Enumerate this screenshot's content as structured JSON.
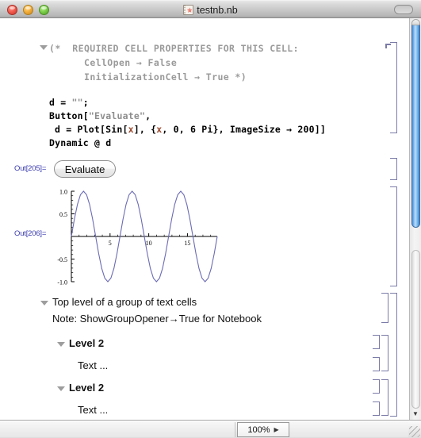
{
  "window": {
    "title": "testnb.nb",
    "icon": "mathematica-notebook-icon",
    "close_label": "",
    "minimize_label": "",
    "maximize_label": "",
    "toolbar_toggle_label": ""
  },
  "code_cell": {
    "opener": "▼",
    "comment": {
      "line1": "(*  REQUIRED CELL PROPERTIES FOR THIS CELL:",
      "line2": "CellOpen → False",
      "line3": "InitializationCell → True *)"
    },
    "lines": {
      "l1_a": "d = ",
      "l1_str": "\"\"",
      "l1_b": ";",
      "l2_a": "Button[",
      "l2_str": "\"Evaluate\"",
      "l2_b": ",",
      "l3_a": "d = Plot[Sin[",
      "l3_x1": "x",
      "l3_b": "], {",
      "l3_x2": "x",
      "l3_c": ", 0, 6 Pi}, ImageSize → 200]]",
      "l4": "Dynamic @ d"
    }
  },
  "outputs": {
    "out205_label": "Out[205]=",
    "evaluate_button_label": "Evaluate",
    "out206_label": "Out[206]="
  },
  "chart_data": {
    "type": "line",
    "title": "",
    "xlabel": "",
    "ylabel": "",
    "expression": "Sin[x]",
    "xlim": [
      0,
      18.8496
    ],
    "ylim": [
      -1.0,
      1.0
    ],
    "xticks": [
      5,
      10,
      15
    ],
    "xtick_labels": [
      "5",
      "10",
      "15"
    ],
    "yticks": [
      -1.0,
      -0.5,
      0.5,
      1.0
    ],
    "ytick_labels": [
      "-1.0",
      "-0.5",
      "0.5",
      "1.0"
    ],
    "grid": false,
    "legend": false,
    "line_color": "#6a6ab4",
    "axis_color": "#000000",
    "image_size": 200,
    "series": [
      {
        "name": "Sin[x]",
        "x": [
          0,
          0.3927,
          0.7854,
          1.1781,
          1.5708,
          1.9635,
          2.3562,
          2.7489,
          3.1416,
          3.5343,
          3.927,
          4.3197,
          4.7124,
          5.1051,
          5.4978,
          5.8905,
          6.2832,
          6.6759,
          7.0686,
          7.4613,
          7.854,
          8.2467,
          8.6394,
          9.0321,
          9.4248,
          9.8175,
          10.2102,
          10.6029,
          10.9956,
          11.3883,
          11.781,
          12.1737,
          12.5664,
          12.9591,
          13.3518,
          13.7445,
          14.1372,
          14.5299,
          14.9226,
          15.3153,
          15.708,
          16.1007,
          16.4934,
          16.8861,
          17.2788,
          17.6715,
          18.0642,
          18.4569,
          18.8496
        ],
        "y": [
          0,
          0.3827,
          0.7071,
          0.9239,
          1.0,
          0.9239,
          0.7071,
          0.3827,
          0,
          -0.3827,
          -0.7071,
          -0.9239,
          -1.0,
          -0.9239,
          -0.7071,
          -0.3827,
          0,
          0.3827,
          0.7071,
          0.9239,
          1.0,
          0.9239,
          0.7071,
          0.3827,
          0,
          -0.3827,
          -0.7071,
          -0.9239,
          -1.0,
          -0.9239,
          -0.7071,
          -0.3827,
          0,
          0.3827,
          0.7071,
          0.9239,
          1.0,
          0.9239,
          0.7071,
          0.3827,
          0,
          -0.3827,
          -0.7071,
          -0.9239,
          -1.0,
          -0.9239,
          -0.7071,
          -0.3827,
          0
        ]
      }
    ]
  },
  "text_cells": {
    "top_level": "Top level of a group of text cells",
    "note": "Note: ShowGroupOpener→True for Notebook",
    "level2_a": "Level 2",
    "text_a": "Text ...",
    "level2_b": "Level 2",
    "text_b": "Text ..."
  },
  "status_bar": {
    "zoom_value": "100%",
    "zoom_arrow": "▶"
  },
  "scrollbar": {
    "down_arrow": "▼"
  }
}
